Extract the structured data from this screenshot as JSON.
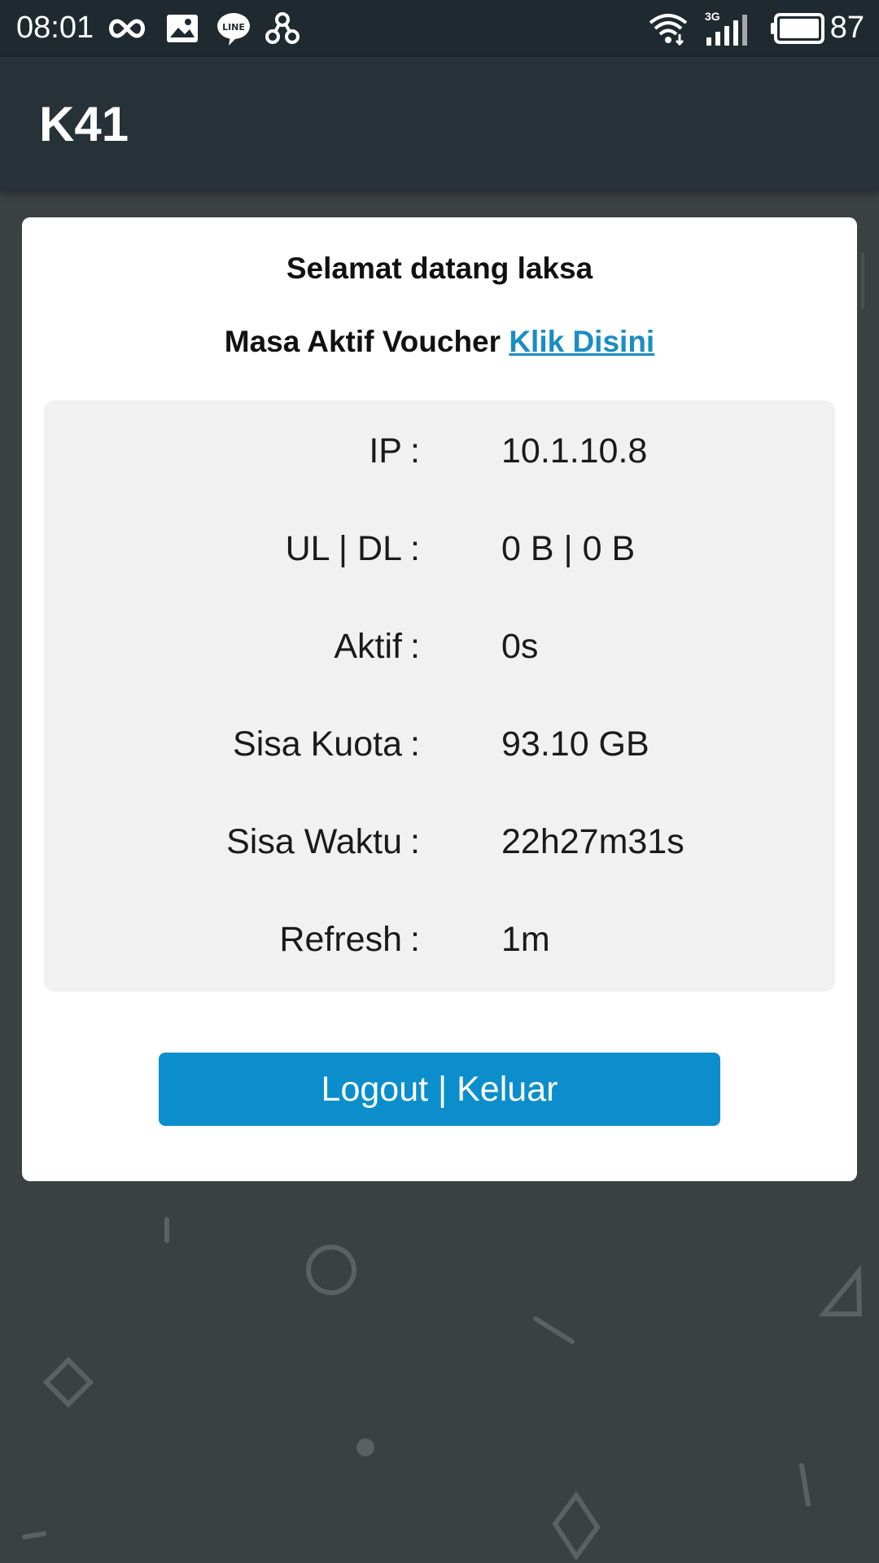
{
  "status_bar": {
    "time": "08:01",
    "battery": "87",
    "network_type": "3G",
    "icons": [
      "infinity-icon",
      "image-icon",
      "line-app-icon",
      "link-icon",
      "wifi-icon",
      "signal-icon",
      "battery-icon"
    ]
  },
  "app_bar": {
    "title": "K41"
  },
  "card": {
    "welcome": "Selamat datang laksa",
    "voucher_text": "Masa Aktif Voucher",
    "voucher_link": "Klik Disini",
    "rows": [
      {
        "label": "IP",
        "separator": ":",
        "value": "10.1.10.8"
      },
      {
        "label": "UL | DL",
        "separator": ":",
        "value": "0 B | 0 B"
      },
      {
        "label": "Aktif",
        "separator": ":",
        "value": "0s"
      },
      {
        "label": "Sisa Kuota",
        "separator": ":",
        "value": "93.10 GB"
      },
      {
        "label": "Sisa Waktu",
        "separator": ":",
        "value": "22h27m31s"
      },
      {
        "label": "Refresh",
        "separator": ":",
        "value": "1m"
      }
    ],
    "logout_label": "Logout | Keluar"
  },
  "colors": {
    "status_bar": "#1f2a30",
    "app_bar": "#263238",
    "background": "#3b4141",
    "link": "#1b8cc4",
    "button": "#0b8ecb",
    "panel": "#f1f1f1"
  }
}
